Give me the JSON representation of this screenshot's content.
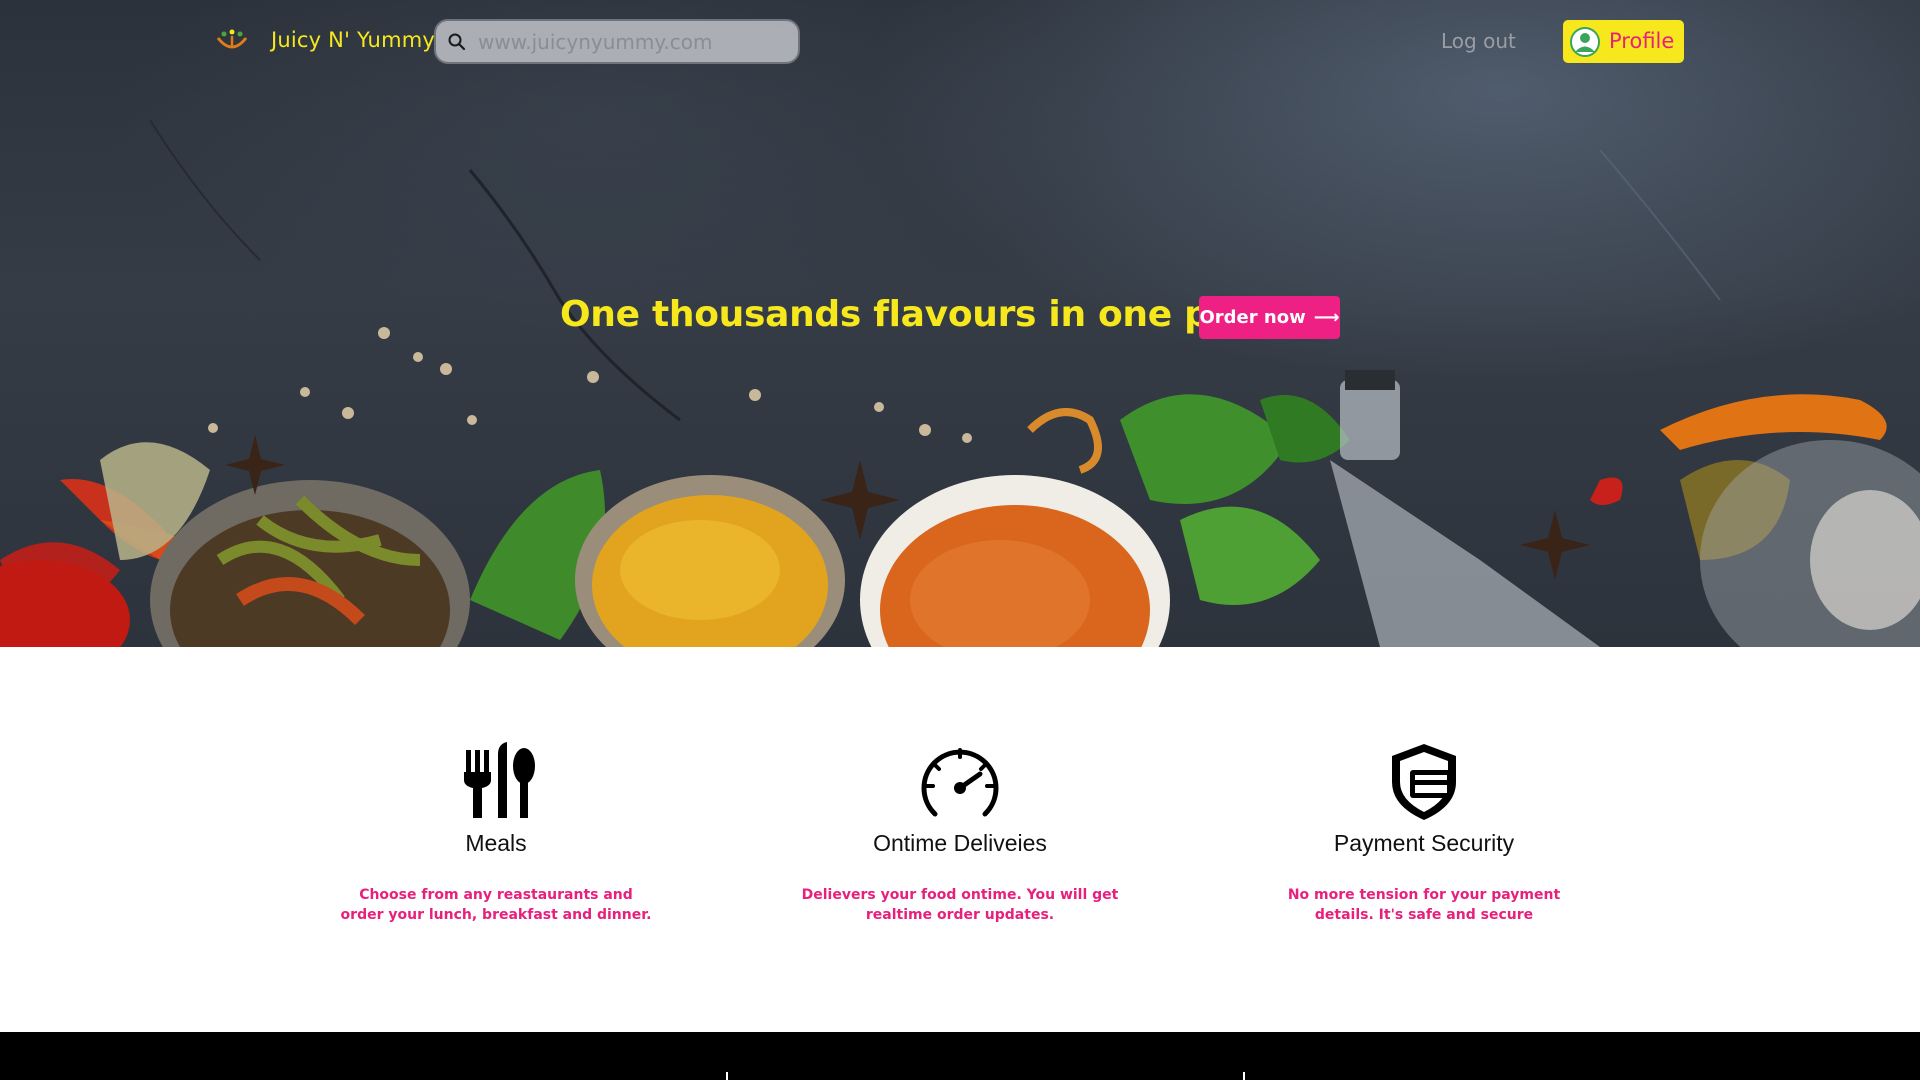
{
  "nav": {
    "brand": "Juicy N' Yummy",
    "search_placeholder": "www.juicynyummy.com",
    "logout_label": "Log out",
    "profile_label": "Profile"
  },
  "hero": {
    "headline": "One thousands flavours in one place",
    "order_label": "Order now",
    "order_arrow": "⟶"
  },
  "features": [
    {
      "icon": "cutlery-icon",
      "title": "Meals",
      "description": "Choose from any reastaurants and order your lunch, breakfast and dinner."
    },
    {
      "icon": "speedometer-icon",
      "title": "Ontime Deliveies",
      "description": "Delievers your food ontime. You will get realtime order updates."
    },
    {
      "icon": "shield-icon",
      "title": "Payment Security",
      "description": "No more tension for your payment details. It's safe and secure"
    }
  ],
  "colors": {
    "accent_yellow": "#f6e81c",
    "accent_pink": "#ee2083",
    "hero_dark": "#2f353e",
    "footer": "#000000"
  }
}
